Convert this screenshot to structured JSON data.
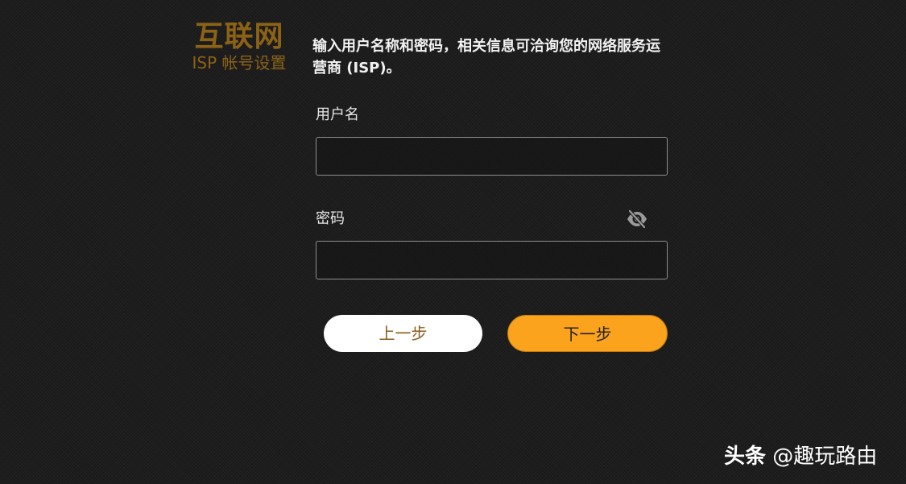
{
  "colors": {
    "background": "#1d1d1d",
    "brand_accent": "#8b6216",
    "next_button": "#fba31d",
    "prev_button_bg": "#ffffff",
    "prev_button_text": "#8a5d1c"
  },
  "brand": {
    "title": "互联网",
    "subtitle": "ISP 帐号设置"
  },
  "instruction": "输入用户名称和密码，相关信息可洽询您的网络服务运营商 (ISP)。",
  "form": {
    "username": {
      "label": "用户名",
      "value": "",
      "placeholder": ""
    },
    "password": {
      "label": "密码",
      "value": "",
      "placeholder": "",
      "toggle_icon": "eye-off-icon"
    }
  },
  "buttons": {
    "prev_label": "上一步",
    "next_label": "下一步"
  },
  "watermark": {
    "source": "头条",
    "account": "@趣玩路由"
  }
}
